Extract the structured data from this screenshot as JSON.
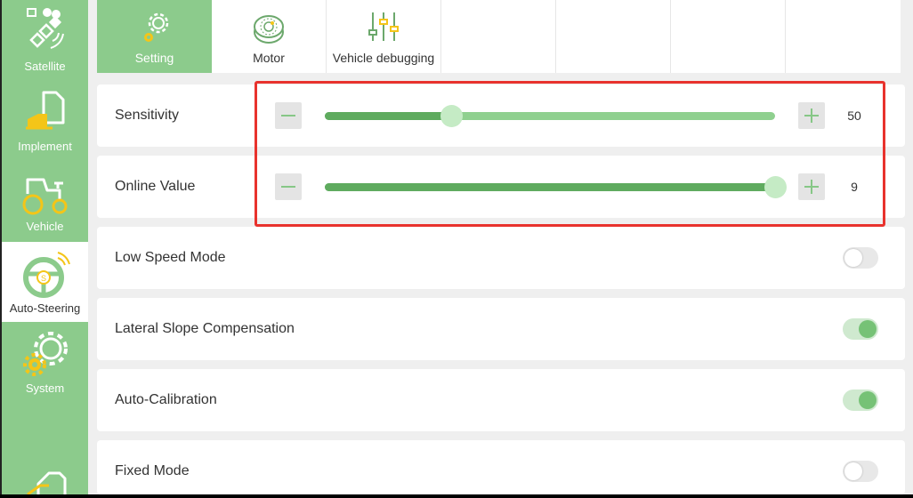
{
  "colors": {
    "accent_green": "#8ccb8c",
    "slider_fill": "#5fab5f",
    "slider_track": "#8fd08f",
    "highlight_red": "#e8322d",
    "toggle_on": "#76c276"
  },
  "sidebar": {
    "items": [
      {
        "label": "Satellite",
        "icon": "satellite-icon",
        "active": false
      },
      {
        "label": "Implement",
        "icon": "implement-icon",
        "active": false
      },
      {
        "label": "Vehicle",
        "icon": "tractor-icon",
        "active": false
      },
      {
        "label": "Auto-Steering",
        "icon": "steering-wheel-icon",
        "active": true
      },
      {
        "label": "System",
        "icon": "system-gear-icon",
        "active": false
      }
    ]
  },
  "tabs": [
    {
      "label": "Setting",
      "icon": "gear-icon",
      "active": true
    },
    {
      "label": "Motor",
      "icon": "motor-icon",
      "active": false
    },
    {
      "label": "Vehicle debugging",
      "icon": "sliders-icon",
      "active": false
    }
  ],
  "settings": {
    "sensitivity": {
      "label": "Sensitivity",
      "value": "50",
      "level": 0.28
    },
    "online_value": {
      "label": "Online Value",
      "value": "9",
      "level": 1.0
    },
    "low_speed_mode": {
      "label": "Low Speed Mode",
      "on": false
    },
    "lateral_slope": {
      "label": "Lateral Slope Compensation",
      "on": true
    },
    "auto_calibration": {
      "label": "Auto-Calibration",
      "on": true
    },
    "fixed_mode": {
      "label": "Fixed Mode",
      "on": false
    }
  }
}
